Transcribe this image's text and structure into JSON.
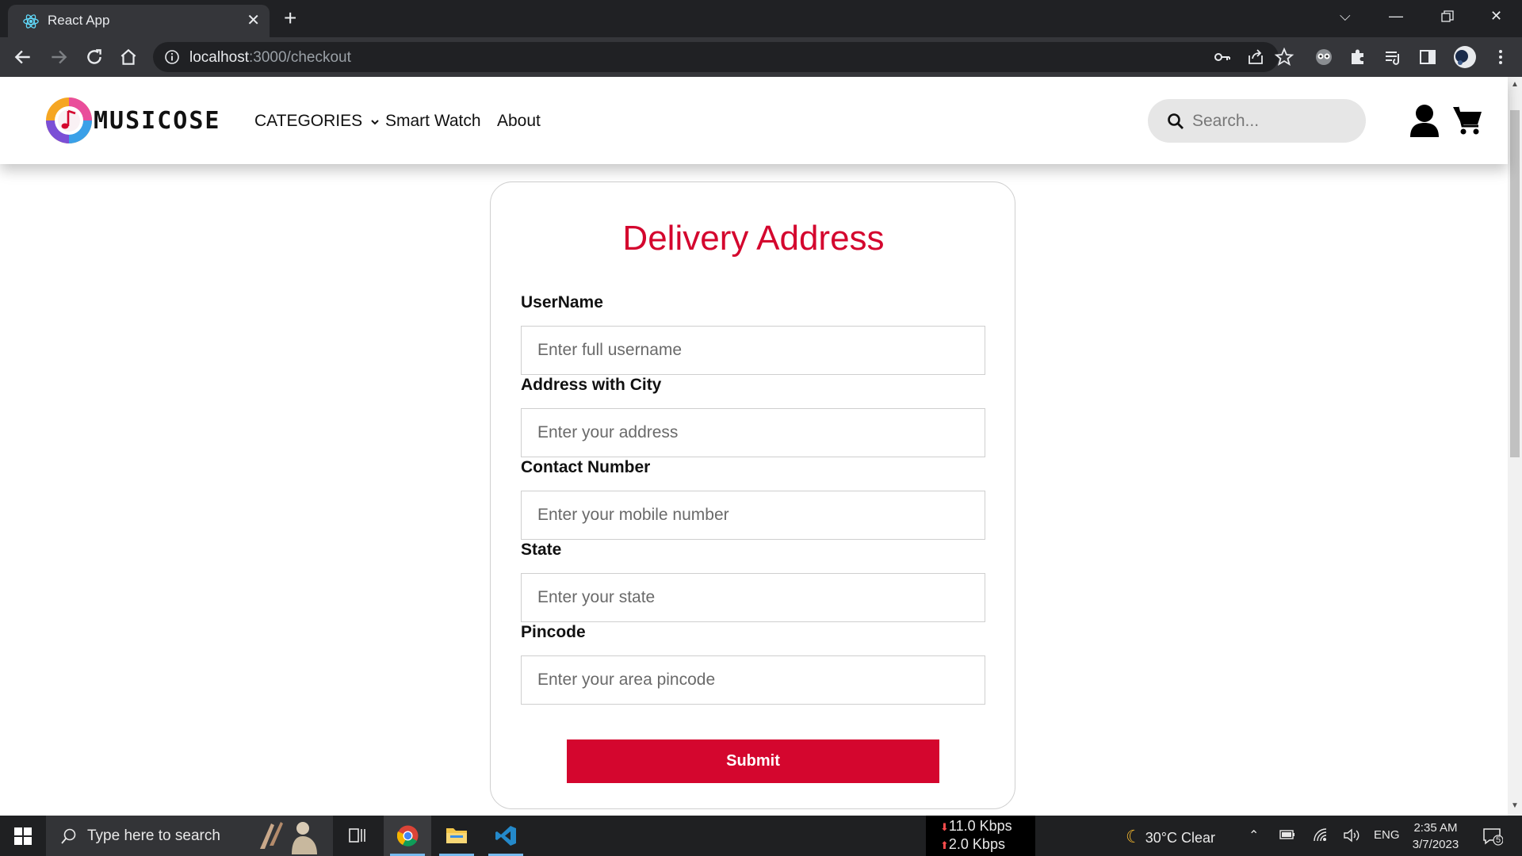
{
  "browser": {
    "tab_title": "React App",
    "url_host": "localhost",
    "url_rest": ":3000/checkout"
  },
  "site": {
    "logo_text": "MUSICOSE",
    "nav": {
      "categories": "CATEGORIES",
      "smart_watch": "Smart Watch",
      "about": "About"
    },
    "search_placeholder": "Search..."
  },
  "form": {
    "title": "Delivery Address",
    "fields": [
      {
        "label": "UserName",
        "placeholder": "Enter full username"
      },
      {
        "label": "Address with City",
        "placeholder": "Enter your address"
      },
      {
        "label": "Contact Number",
        "placeholder": "Enter your mobile number"
      },
      {
        "label": "State",
        "placeholder": "Enter your state"
      },
      {
        "label": "Pincode",
        "placeholder": "Enter your area pincode"
      }
    ],
    "submit_label": "Submit"
  },
  "taskbar": {
    "search_placeholder": "Type here to search",
    "net_down": "11.0 Kbps",
    "net_up": "2.0 Kbps",
    "weather": "30°C  Clear",
    "lang": "ENG",
    "time": "2:35 AM",
    "date": "3/7/2023",
    "notification_count": "5"
  },
  "colors": {
    "accent": "#d4062e",
    "chrome_dark": "#202124",
    "chrome_toolbar": "#35363a"
  }
}
